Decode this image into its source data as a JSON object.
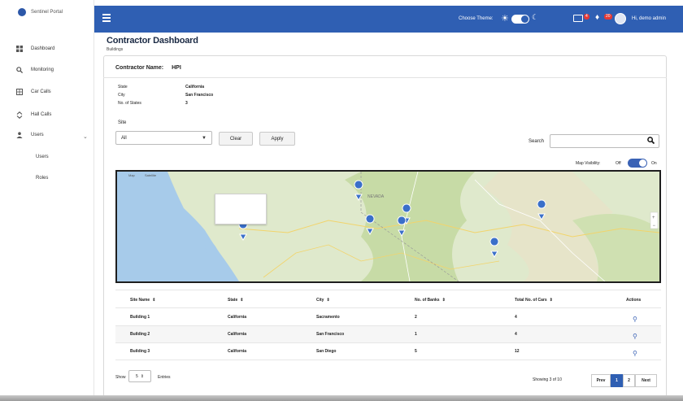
{
  "brand": {
    "name": "Sentinel Portal"
  },
  "sidebar": {
    "items": [
      {
        "label": "Dashboard",
        "icon": "dashboard-icon"
      },
      {
        "label": "Monitoring",
        "icon": "search-icon"
      },
      {
        "label": "Car Calls",
        "icon": "car-calls-icon"
      },
      {
        "label": "Hall Calls",
        "icon": "hall-calls-icon"
      },
      {
        "label": "Users",
        "icon": "users-icon"
      }
    ],
    "subitems": [
      {
        "label": "Users"
      },
      {
        "label": "Roles"
      }
    ]
  },
  "header": {
    "theme_label": "Choose Theme:",
    "mail_badge": "4",
    "bell_badge": "20",
    "user_name": "Hi, demo admin"
  },
  "page": {
    "title": "Contractor Dashboard",
    "breadcrumb": "Buildings"
  },
  "contractor": {
    "name_label": "Contractor Name:",
    "name_value": "HPI",
    "fields": [
      {
        "label": "State",
        "value": "California"
      },
      {
        "label": "City",
        "value": "San Francisco"
      },
      {
        "label": "No. of States",
        "value": "3"
      }
    ]
  },
  "filters": {
    "site_label": "Site",
    "site_value": "All",
    "clear_label": "Clear",
    "apply_label": "Apply",
    "search_label": "Search",
    "search_placeholder": "",
    "map_visibility_label": "Map Visibility:",
    "off_label": "Off",
    "on_label": "On",
    "map_visible": true
  },
  "map": {
    "tabs": [
      "Map",
      "Satellite"
    ],
    "label": "NEVADA",
    "pins": [
      {
        "name": "pin-1"
      },
      {
        "name": "pin-2"
      },
      {
        "name": "pin-3"
      },
      {
        "name": "pin-4"
      },
      {
        "name": "pin-5"
      },
      {
        "name": "pin-6"
      },
      {
        "name": "pin-7"
      }
    ]
  },
  "table": {
    "columns": [
      "Site Name",
      "State",
      "City",
      "No. of Banks",
      "Total No. of Cars",
      "Actions"
    ],
    "rows": [
      {
        "site": "Building 1",
        "state": "California",
        "city": "Sacramento",
        "banks": "2",
        "cars": "4"
      },
      {
        "site": "Building 2",
        "state": "California",
        "city": "San Francisco",
        "banks": "1",
        "cars": "4"
      },
      {
        "site": "Building 3",
        "state": "California",
        "city": "San Diego",
        "banks": "5",
        "cars": "12"
      }
    ]
  },
  "footer": {
    "show_label": "Show",
    "page_size": "5",
    "entries_label": "Entries",
    "showing_text": "Showing 3 of 10",
    "prev_label": "Prev",
    "pages": [
      "1",
      "2"
    ],
    "next_label": "Next"
  },
  "colors": {
    "primary": "#2f5fb3",
    "sidebar_bg": "#ffffff",
    "card_border": "#d8d8d8"
  }
}
